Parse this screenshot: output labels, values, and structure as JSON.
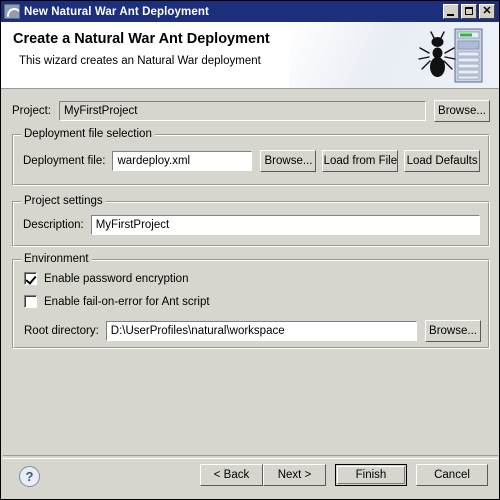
{
  "window": {
    "title": "New Natural War Ant Deployment",
    "icon": "wizard-window-icon",
    "minimize_label": "",
    "maximize_label": "",
    "close_label": "✕"
  },
  "banner": {
    "title": "Create a Natural War Ant Deployment",
    "subtitle": "This wizard creates an Natural War deployment",
    "art": "ant-and-server-icon"
  },
  "project": {
    "label": "Project:",
    "value": "MyFirstProject",
    "placeholder": "",
    "browse_label": "Browse..."
  },
  "deployment_group": {
    "title": "Deployment file selection",
    "file_label": "Deployment file:",
    "file_value": "wardeploy.xml",
    "file_placeholder": "",
    "browse_label": "Browse...",
    "load_from_file_label": "Load from File",
    "load_defaults_label": "Load Defaults"
  },
  "project_settings_group": {
    "title": "Project settings",
    "description_label": "Description:",
    "description_value": "MyFirstProject",
    "description_placeholder": ""
  },
  "environment_group": {
    "title": "Environment",
    "checkboxes": [
      {
        "label": "Enable password encryption",
        "checked": true
      },
      {
        "label": "Enable fail-on-error for Ant script",
        "checked": false
      }
    ],
    "root_label": "Root directory:",
    "root_value": "D:\\UserProfiles\\natural\\workspace",
    "root_placeholder": "",
    "browse_label": "Browse..."
  },
  "footer": {
    "help_label": "?",
    "back_label": "< Back",
    "next_label": "Next >",
    "finish_label": "Finish",
    "cancel_label": "Cancel"
  },
  "colors": {
    "titlebar": "#1c2f7c",
    "dialog_bg": "#d6d6ce",
    "field_bg": "#ffffff",
    "banner_bg": "#ffffff",
    "text": "#000000"
  }
}
